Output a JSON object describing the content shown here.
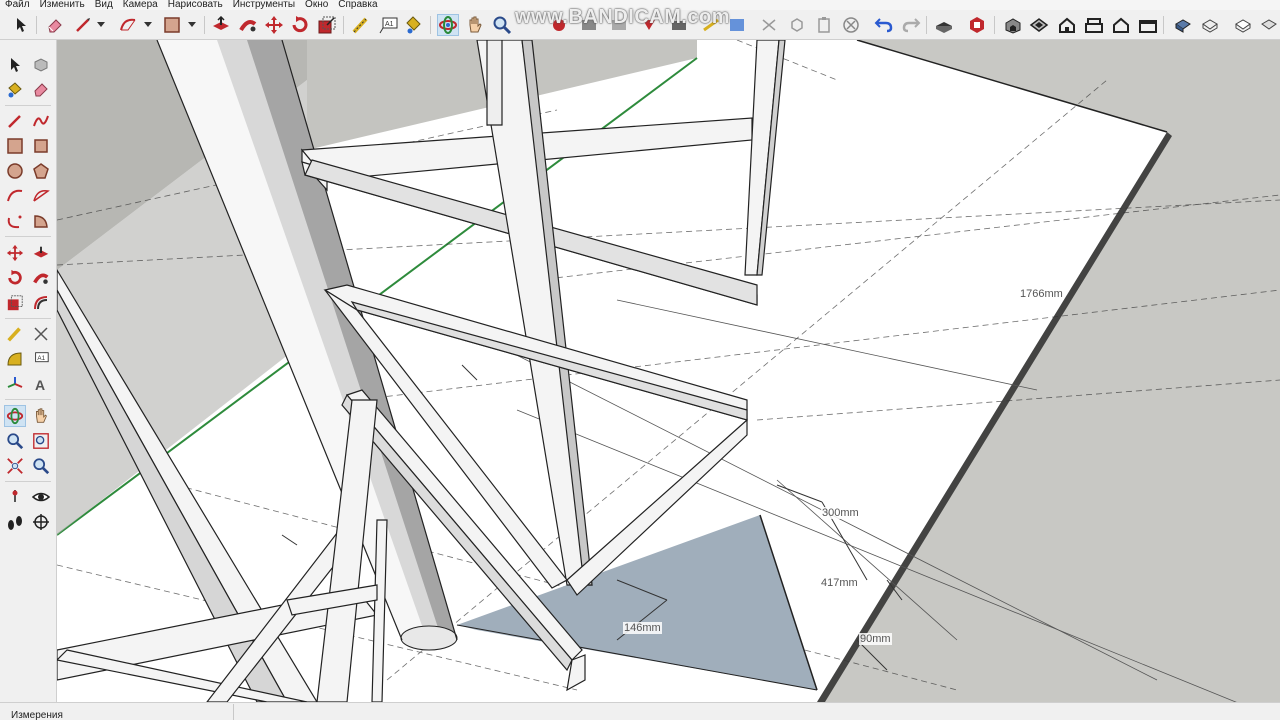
{
  "menu": [
    "Файл",
    "Изменить",
    "Вид",
    "Камера",
    "Нарисовать",
    "Инструменты",
    "Окно",
    "Справка"
  ],
  "watermark": "www.BANDICAM.com",
  "dimensions": {
    "d1766": "1766mm",
    "d300": "300mm",
    "d417": "417mm",
    "d146": "146mm",
    "d90": "90mm"
  },
  "status": {
    "measurements_label": "Измерения"
  },
  "colors": {
    "ground": "#c8c8c4",
    "wall": "#b4b4b0",
    "green_edge": "#2e8b3c",
    "highlight": "#a0aebb",
    "active_tool": "#cfe3f3"
  }
}
